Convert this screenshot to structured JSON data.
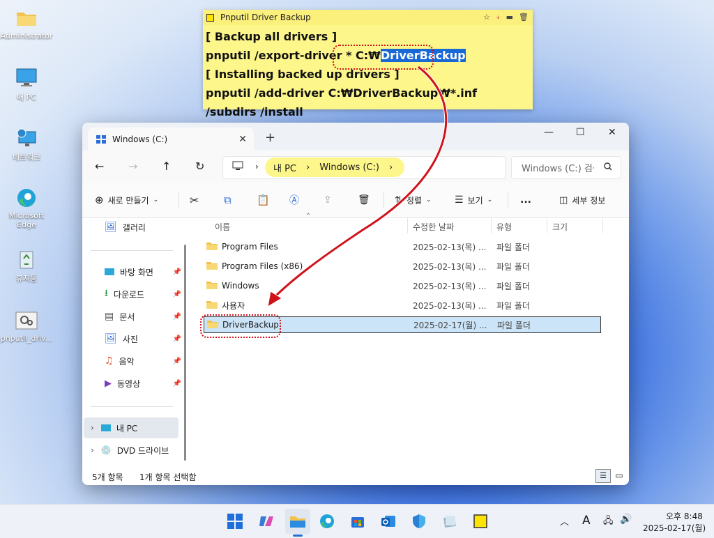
{
  "desktop": {
    "icons": [
      {
        "label": "Administrator"
      },
      {
        "label": "내 PC"
      },
      {
        "label": "네트워크"
      },
      {
        "label": "Microsoft Edge"
      },
      {
        "label": "휴지통"
      },
      {
        "label": "pnputil_driv..."
      }
    ]
  },
  "sticky": {
    "title": "Pnputil Driver Backup",
    "lines": [
      "[ Backup all drivers ]",
      "pnputil /export-driver * C:\\DriverBackup",
      "[ Installing backed up drivers ]",
      "pnputil /add-driver C:\\DriverBackup\\*.inf /subdirs /install"
    ],
    "line2_prefix": "pnputil /export-driver * ",
    "line2_drive": "C:₩",
    "line2_highlight": "DriverBackup",
    "line4": "pnputil /add-driver C:₩DriverBackup₩*.inf /subdirs /install",
    "highlight_color": "#1868d6"
  },
  "explorer": {
    "tab_title": "Windows (C:)",
    "new_tab": "+",
    "breadcrumb": [
      "내 PC",
      "Windows (C:)"
    ],
    "search_placeholder": "Windows (C:) 검색",
    "toolbar": {
      "new": "새로 만들기",
      "sort": "정렬",
      "view": "보기",
      "more": "...",
      "details": "세부 정보"
    },
    "sidebar": [
      {
        "label": "갤러리",
        "icon": "gallery-icon",
        "pinned": false
      },
      {
        "label": "바탕 화면",
        "icon": "desktop-icon",
        "pinned": true
      },
      {
        "label": "다운로드",
        "icon": "download-icon",
        "pinned": true
      },
      {
        "label": "문서",
        "icon": "document-icon",
        "pinned": true
      },
      {
        "label": "사진",
        "icon": "picture-icon",
        "pinned": true
      },
      {
        "label": "음악",
        "icon": "music-icon",
        "pinned": true
      },
      {
        "label": "동영상",
        "icon": "video-icon",
        "pinned": true
      },
      {
        "label": "내 PC",
        "icon": "pc-icon",
        "pinned": false
      },
      {
        "label": "DVD 드라이브",
        "icon": "dvd-icon",
        "pinned": false
      }
    ],
    "columns": [
      "이름",
      "수정한 날짜",
      "유형",
      "크기"
    ],
    "files": [
      {
        "name": "Program Files",
        "date": "2025-02-13(목) ...",
        "type": "파일 폴더"
      },
      {
        "name": "Program Files (x86)",
        "date": "2025-02-13(목) ...",
        "type": "파일 폴더"
      },
      {
        "name": "Windows",
        "date": "2025-02-13(목) ...",
        "type": "파일 폴더"
      },
      {
        "name": "사용자",
        "date": "2025-02-13(목) ...",
        "type": "파일 폴더"
      },
      {
        "name": "DriverBackup",
        "date": "2025-02-17(월) ...",
        "type": "파일 폴더"
      }
    ],
    "status": {
      "count": "5개 항목",
      "selected": "1개 항목 선택함"
    }
  },
  "taskbar": {
    "time": "오후 8:48",
    "date": "2025-02-17(월)",
    "ime": "A"
  },
  "colors": {
    "sticky": "#fdf68a",
    "annotation_ring": "#d0121b",
    "selection": "#cce4f7"
  }
}
